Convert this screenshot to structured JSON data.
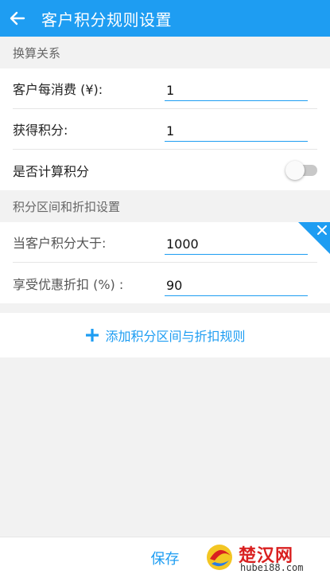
{
  "header": {
    "title": "客户积分规则设置"
  },
  "conversion": {
    "section_title": "换算关系",
    "spend_label": "客户每消费 (¥):",
    "spend_value": "1",
    "earn_label": "获得积分:",
    "earn_value": "1",
    "calc_label": "是否计算积分",
    "calc_enabled": false
  },
  "discount": {
    "section_title": "积分区间和折扣设置",
    "threshold_label": "当客户积分大于:",
    "threshold_value": "1000",
    "discount_label": "享受优惠折扣 (%) :",
    "discount_value": "90"
  },
  "add_rule_label": "添加积分区间与折扣规则",
  "save_label": "保存",
  "watermark": {
    "name": "楚汉网",
    "url": "hubei88.com"
  },
  "colors": {
    "accent": "#1e9df2",
    "toggle_off": "#c8c8c8"
  }
}
